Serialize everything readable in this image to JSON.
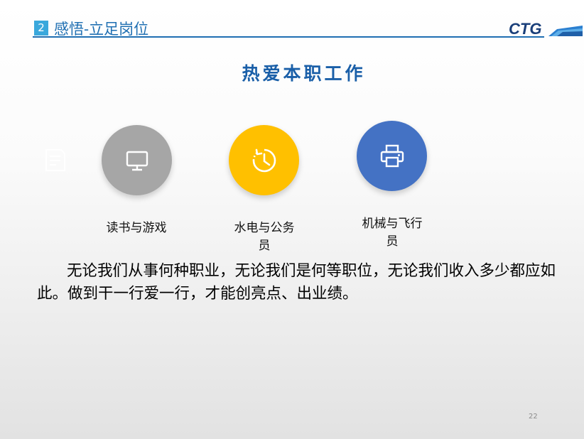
{
  "header": {
    "section_number": "2",
    "title": "感悟-立足岗位",
    "logo_text": "CTG",
    "accent_color": "#1f6fb2"
  },
  "main": {
    "title": "热爱本职工作",
    "items": [
      {
        "label_line1": "读书与游戏",
        "label_line2": "",
        "icon": "monitor-icon",
        "color": "#a6a6a6"
      },
      {
        "label_line1": "水电与公务",
        "label_line2": "员",
        "icon": "clock-icon",
        "color": "#ffc000"
      },
      {
        "label_line1": "机械与飞行",
        "label_line2": "员",
        "icon": "printer-icon",
        "color": "#4472c4"
      }
    ],
    "side_icon": "document-icon",
    "body_text": "无论我们从事何种职业，无论我们是何等职位，无论我们收入多少都应如此。做到干一行爱一行，才能创亮点、出业绩。"
  },
  "footer": {
    "page_number": "22"
  }
}
